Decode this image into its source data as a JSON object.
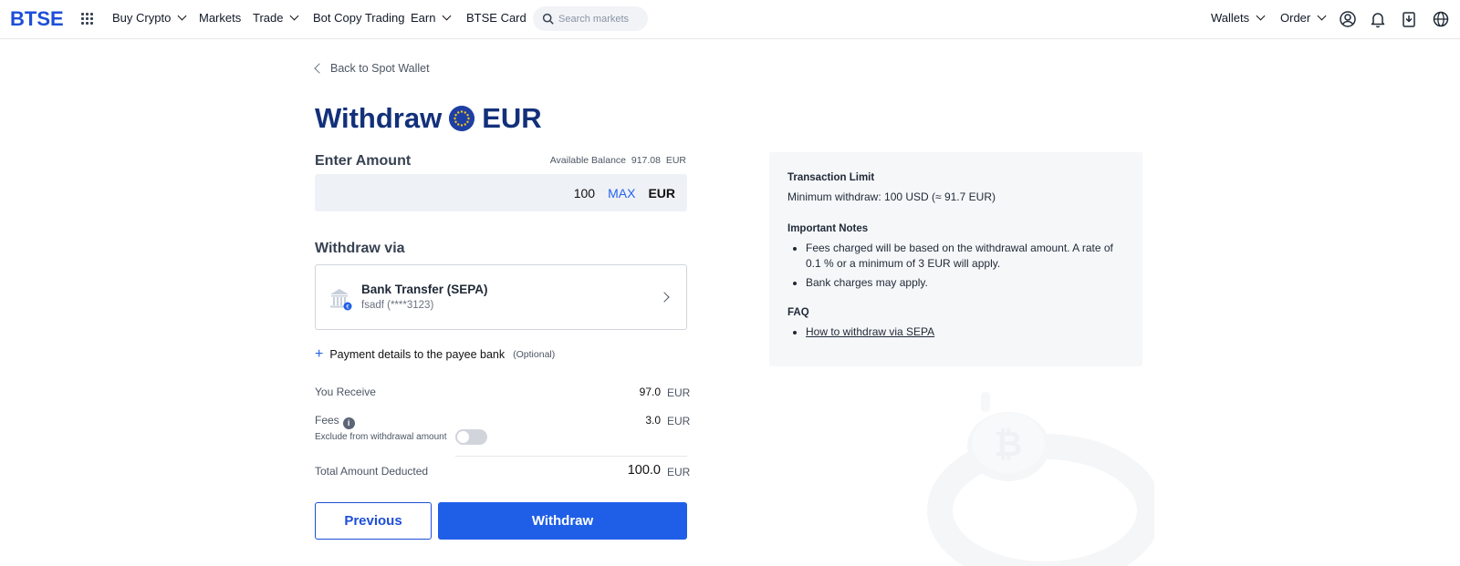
{
  "header": {
    "logo": "BTSE",
    "nav": [
      "Buy Crypto",
      "Markets",
      "Trade",
      "Bot Copy Trading",
      "Earn",
      "BTSE Card"
    ],
    "search_placeholder": "Search markets",
    "right": {
      "wallets": "Wallets",
      "order": "Order"
    }
  },
  "back_link": "Back to Spot Wallet",
  "page": {
    "title_prefix": "Withdraw",
    "currency": "EUR"
  },
  "amount": {
    "label": "Enter Amount",
    "balance_label": "Available Balance",
    "balance_value": "917.08",
    "balance_currency": "EUR",
    "value": "100",
    "max": "MAX",
    "currency": "EUR"
  },
  "method": {
    "label": "Withdraw via",
    "name": "Bank Transfer (SEPA)",
    "account": "fsadf (****3123)"
  },
  "payment_details": {
    "label": "Payment details to the payee bank",
    "optional": "(Optional)"
  },
  "summary": {
    "receive_label": "You Receive",
    "receive_value": "97.0",
    "receive_currency": "EUR",
    "fees_label": "Fees",
    "fees_value": "3.0",
    "fees_currency": "EUR",
    "exclude_label": "Exclude from withdrawal amount",
    "exclude_on": false,
    "total_label": "Total Amount Deducted",
    "total_value": "100.0",
    "total_currency": "EUR"
  },
  "buttons": {
    "previous": "Previous",
    "withdraw": "Withdraw"
  },
  "info": {
    "limit_title": "Transaction Limit",
    "limit_text": "Minimum withdraw: 100 USD (≈ 91.7 EUR)",
    "notes_title": "Important Notes",
    "notes": [
      "Fees charged will be based on the withdrawal amount. A rate of 0.1 % or a minimum of 3 EUR will apply.",
      "Bank charges may apply."
    ],
    "faq_title": "FAQ",
    "faq_link": "How to withdraw via SEPA"
  },
  "colors": {
    "brand": "#1d4ed8",
    "title": "#13307a",
    "button": "#1f5fe8"
  }
}
